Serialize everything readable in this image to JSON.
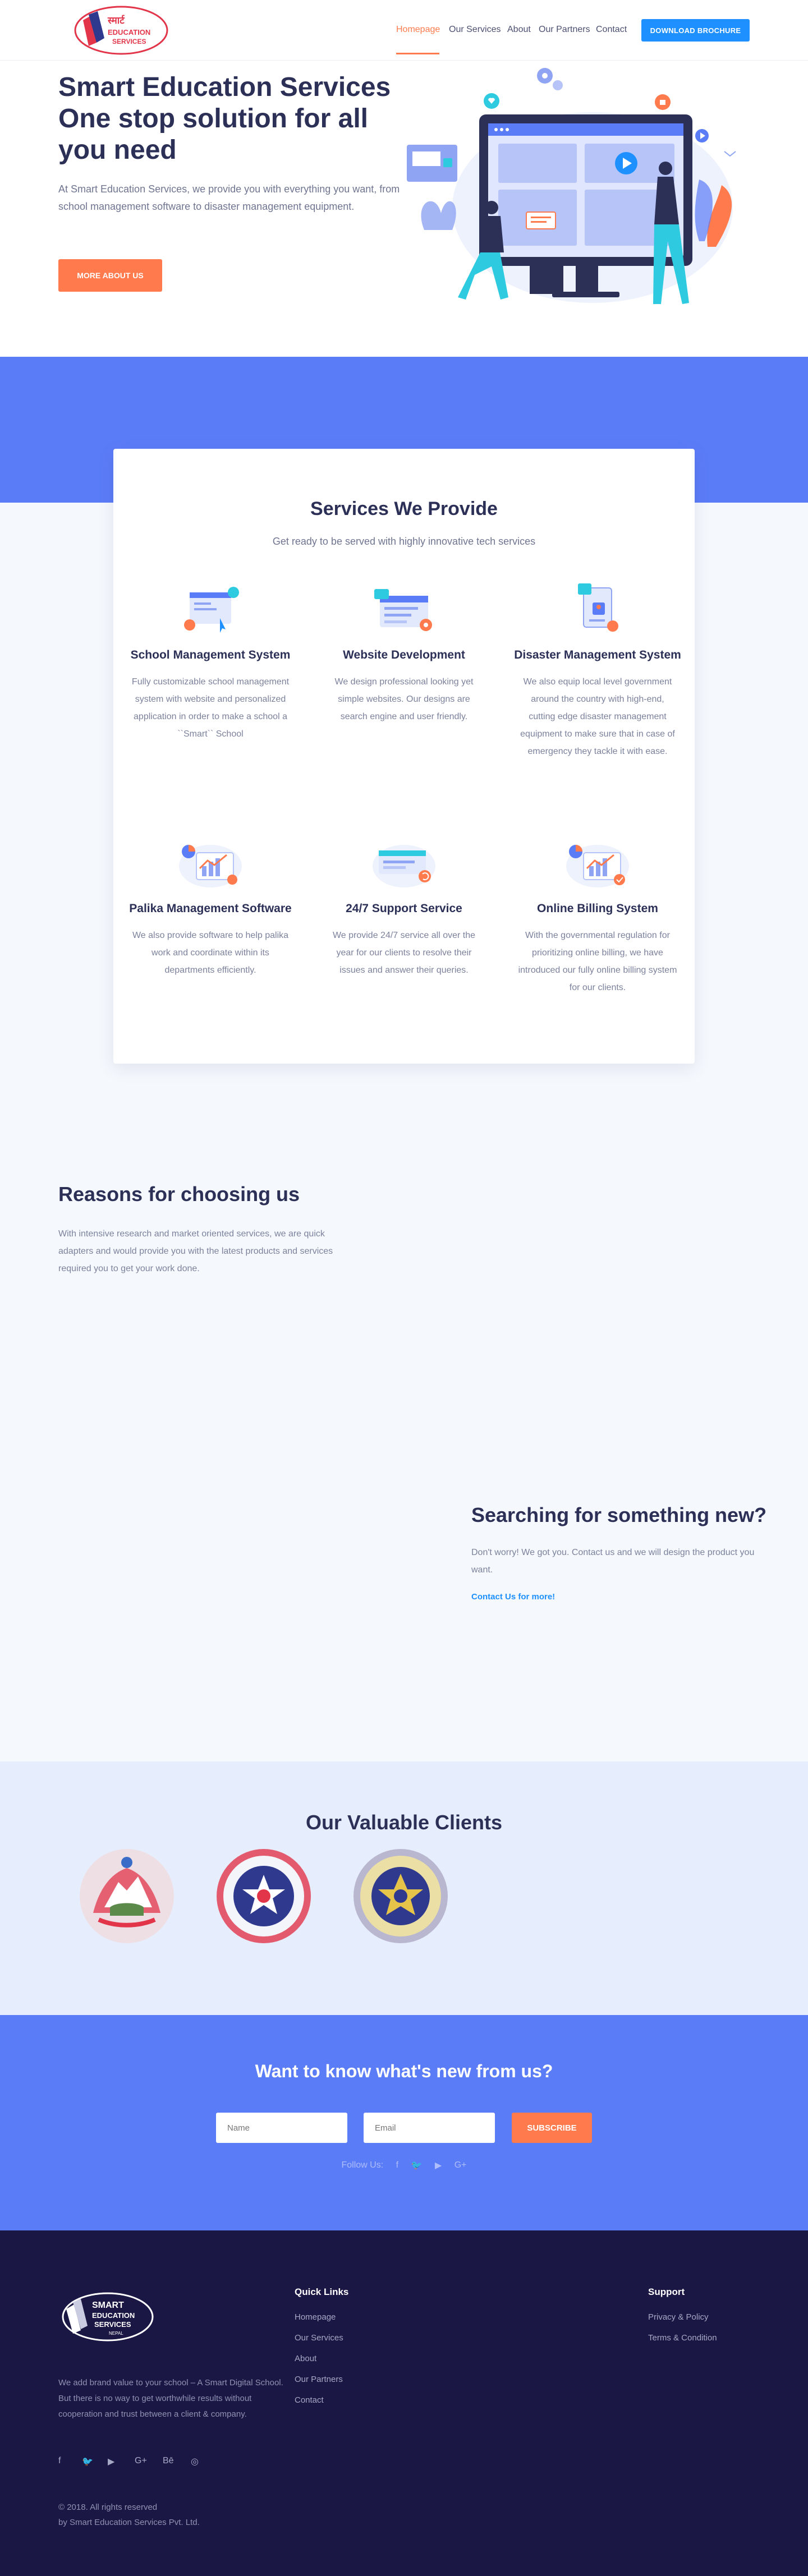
{
  "nav": {
    "items": [
      {
        "label": "Homepage",
        "active": true
      },
      {
        "label": "Our Services",
        "active": false
      },
      {
        "label": "About",
        "active": false
      },
      {
        "label": "Our Partners",
        "active": false
      },
      {
        "label": "Contact",
        "active": false
      }
    ],
    "download_label": "DOWNLOAD BROCHURE",
    "logo_text": [
      "स्मार्ट",
      "EDUCATION",
      "SERVICES"
    ]
  },
  "hero": {
    "title": "Smart Education Services One stop solution for all you need",
    "text": "At Smart Education Services, we provide you with everything you want, from school management software to disaster management equipment.",
    "button_label": "MORE ABOUT US"
  },
  "services": {
    "title": "Services We Provide",
    "subtitle": "Get ready to be served with highly innovative tech services",
    "items": [
      {
        "icon": "school-management-icon",
        "title": "School Management System",
        "text": "Fully customizable school management system with website and personalized application in order to make a school a ``Smart`` School"
      },
      {
        "icon": "website-development-icon",
        "title": "Website Development",
        "text": "We design professional looking yet simple websites. Our designs are search engine and user friendly."
      },
      {
        "icon": "disaster-management-icon",
        "title": "Disaster Management System",
        "text": "We also equip local level government around the country with high-end, cutting edge disaster management equipment to make sure that in case of emergency they tackle it with ease."
      },
      {
        "icon": "palika-management-icon",
        "title": "Palika Management Software",
        "text": "We also provide software to help palika work and coordinate within its departments efficiently."
      },
      {
        "icon": "support-icon",
        "title": "24/7 Support Service",
        "text": "We provide 24/7 service all over the year for our clients to resolve their issues and answer their queries."
      },
      {
        "icon": "billing-icon",
        "title": "Online Billing System",
        "text": "With the governmental regulation for prioritizing online billing, we have introduced our fully online billing system for our clients."
      }
    ]
  },
  "reasons": {
    "title": "Reasons for choosing us",
    "text": "With intensive research and market oriented services, we are quick adapters and would provide you with the latest products and services required you to get your work done."
  },
  "search": {
    "title": "Searching for something new?",
    "text": "Don't worry! We got you. Contact us and we will design the product you want.",
    "link": "Contact Us for more!"
  },
  "clients": {
    "title": "Our Valuable Clients",
    "logos": [
      "nepal-emblem-icon",
      "municipality-seal-icon",
      "rural-municipality-seal-icon"
    ]
  },
  "newsletter": {
    "title": "Want to know what's new from us?",
    "name_placeholder": "Name",
    "email_placeholder": "Email",
    "subscribe_label": "SUBSCRIBE",
    "follow_label": "Follow Us:",
    "social": [
      "f",
      "🐦",
      "▶",
      "G+"
    ]
  },
  "footer": {
    "logo_text": [
      "SMART",
      "EDUCATION",
      "SERVICES",
      "NEPAL"
    ],
    "about": "We add brand value to your school – A Smart Digital School. But there is no way to get worthwhile results without cooperation and trust between a client & company.",
    "social": [
      "f",
      "🐦",
      "▶",
      "G+",
      "Bē",
      "◎"
    ],
    "copyright_line1": "© 2018. All rights reserved",
    "copyright_line2": "by Smart Education Services Pvt. Ltd.",
    "quick_links_title": "Quick Links",
    "quick_links": [
      "Homepage",
      "Our Services",
      "About",
      "Our Partners",
      "Contact"
    ],
    "support_title": "Support",
    "support_links": [
      "Privacy & Policy",
      "Terms & Condition"
    ]
  },
  "colors": {
    "accent": "#ff7a4d",
    "primary": "#5b7cf7",
    "link": "#1e90ff",
    "dark": "#2c3057",
    "footer": "#1b1744"
  }
}
